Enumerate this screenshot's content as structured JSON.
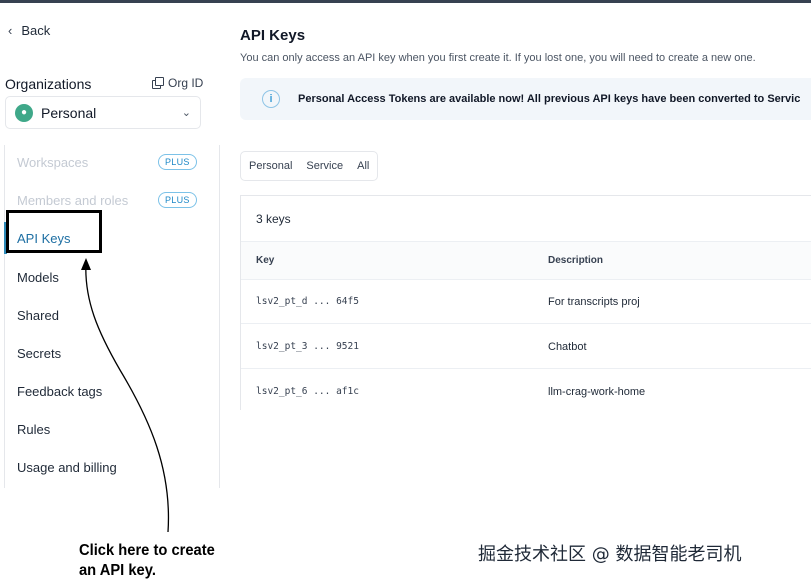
{
  "sidebar": {
    "back_label": "Back",
    "organizations_label": "Organizations",
    "org_id_label": "Org ID",
    "selected_org": "Personal",
    "items": [
      {
        "label": "Workspaces",
        "badge": "PLUS",
        "disabled": true
      },
      {
        "label": "Members and roles",
        "badge": "PLUS",
        "disabled": true
      },
      {
        "label": "API Keys",
        "active": true
      },
      {
        "label": "Models"
      },
      {
        "label": "Shared"
      },
      {
        "label": "Secrets"
      },
      {
        "label": "Feedback tags"
      },
      {
        "label": "Rules"
      },
      {
        "label": "Usage and billing"
      }
    ]
  },
  "main": {
    "title": "API Keys",
    "subtitle": "You can only access an API key when you first create it. If you lost one, you will need to create a new one.",
    "banner": "Personal Access Tokens are available now! All previous API keys have been converted to Servic",
    "tabs": [
      "Personal",
      "Service",
      "All"
    ],
    "count_label": "3 keys",
    "columns": [
      "Key",
      "Description"
    ],
    "rows": [
      {
        "key": "lsv2_pt_d ... 64f5",
        "description": "For transcripts proj"
      },
      {
        "key": "lsv2_pt_3 ... 9521",
        "description": "Chatbot"
      },
      {
        "key": "lsv2_pt_6 ... af1c",
        "description": "llm-crag-work-home"
      }
    ]
  },
  "annotation": {
    "line1": "Click here to create",
    "line2": "an API key."
  },
  "watermark": "掘金技术社区 @ 数据智能老司机",
  "colors": {
    "accent": "#2e8ab8",
    "avatar": "#3fa889",
    "banner_bg": "#f2f6fa",
    "badge": "#1e88c7"
  }
}
